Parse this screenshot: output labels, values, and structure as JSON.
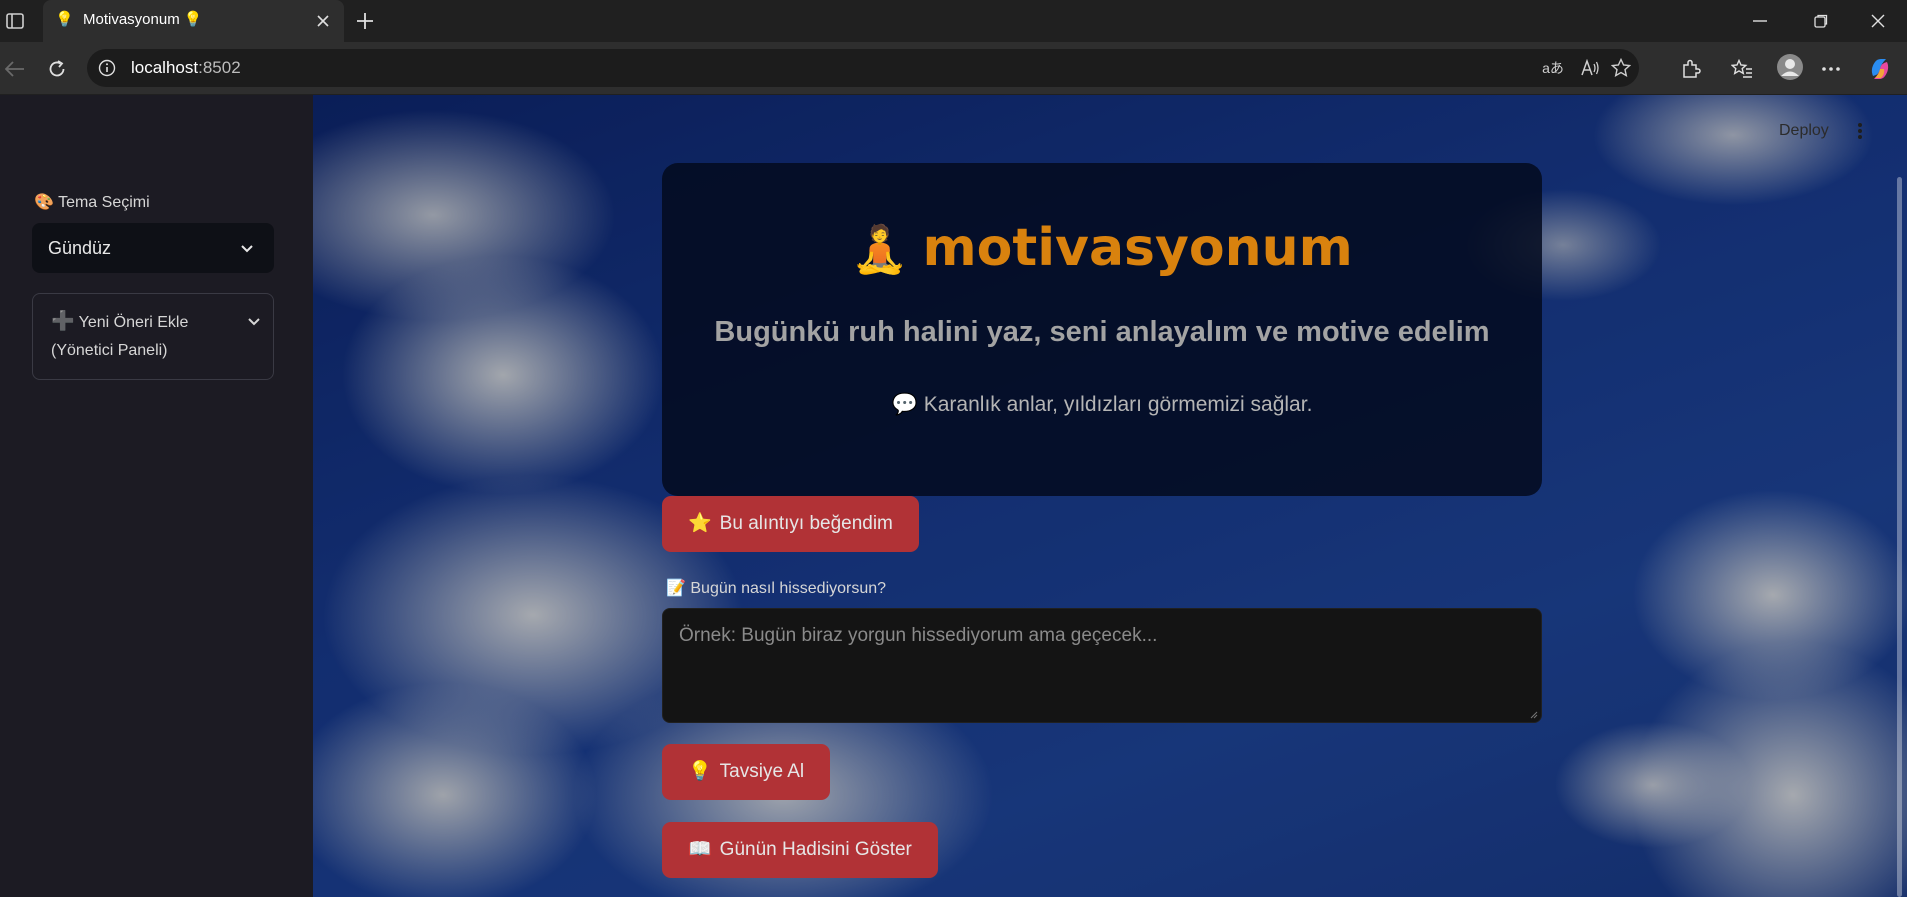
{
  "browser": {
    "tab_title": "Motivasyonum 💡",
    "tab_favicon": "💡",
    "url_host": "localhost",
    "url_port": ":8502",
    "read_aloud_label": "A",
    "translate_label": "aあ"
  },
  "sidebar": {
    "theme_label": "🎨 Tema Seçimi",
    "theme_selected": "Gündüz",
    "expander_label_line1": "Yeni Öneri Ekle",
    "expander_label_line2": "(Yönetici Paneli)",
    "expander_icon": "➕"
  },
  "header": {
    "deploy_label": "Deploy"
  },
  "hero": {
    "emoji": "🧘",
    "title": "motivasyonum",
    "subtitle": "Bugünkü ruh halini yaz, seni anlayalım ve motive edelim",
    "quote_icon": "💬",
    "quote": "Karanlık anlar, yıldızları görmemizi sağlar."
  },
  "actions": {
    "like_icon": "⭐",
    "like_label": "Bu alıntıyı beğendim",
    "mood_label": "📝 Bugün nasıl hissediyorsun?",
    "mood_placeholder": "Örnek: Bugün biraz yorgun hissediyorum ama geçecek...",
    "advice_icon": "💡",
    "advice_label": "Tavsiye Al",
    "hadith_icon": "📖",
    "hadith_label": "Günün Hadisini Göster"
  },
  "colors": {
    "accent_button": "#b13236",
    "title_orange": "#d9820e",
    "sidebar_bg": "#1c1b23"
  }
}
